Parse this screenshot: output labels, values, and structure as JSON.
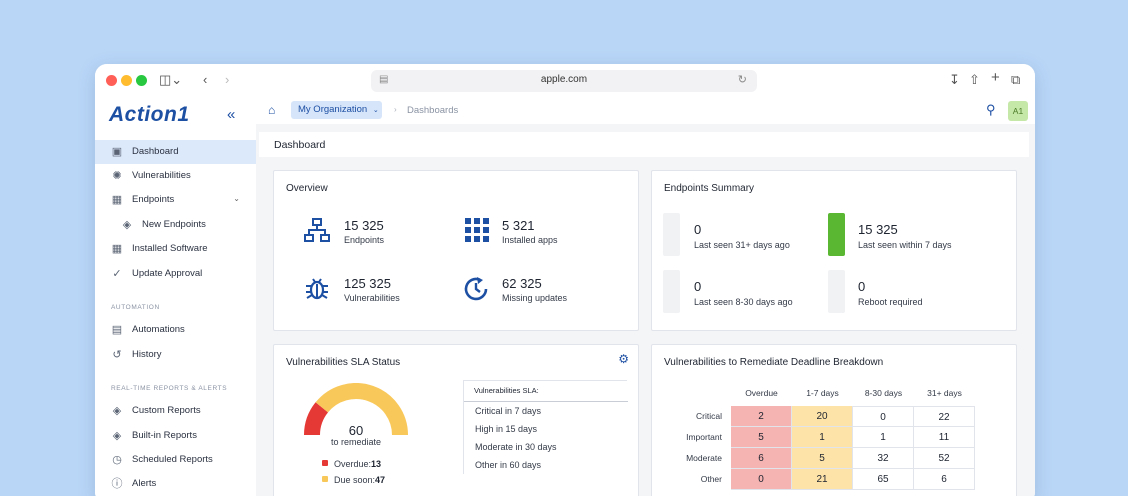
{
  "browser": {
    "url": "apple.com"
  },
  "app": {
    "logo": "Action1"
  },
  "sidebar": {
    "items": [
      {
        "label": "Dashboard",
        "icon": "monitor-icon"
      },
      {
        "label": "Vulnerabilities",
        "icon": "bug-icon"
      },
      {
        "label": "Endpoints",
        "icon": "network-icon"
      },
      {
        "label": "New Endpoints",
        "icon": "layers-icon"
      },
      {
        "label": "Installed Software",
        "icon": "grid-icon"
      },
      {
        "label": "Update Approval",
        "icon": "check-icon"
      }
    ],
    "automation_heading": "AUTOMATION",
    "automation_items": [
      {
        "label": "Automations",
        "icon": "calendar-icon"
      },
      {
        "label": "History",
        "icon": "history-icon"
      }
    ],
    "reports_heading": "REAL-TIME REPORTS & ALERTS",
    "reports_items": [
      {
        "label": "Custom Reports",
        "icon": "layers-icon"
      },
      {
        "label": "Built-in Reports",
        "icon": "layers-icon"
      },
      {
        "label": "Scheduled Reports",
        "icon": "clock-icon"
      },
      {
        "label": "Alerts",
        "icon": "info-icon"
      }
    ]
  },
  "header": {
    "org_label": "My Organization",
    "breadcrumb": "Dashboards",
    "avatar": "A1"
  },
  "page": {
    "title": "Dashboard"
  },
  "overview": {
    "title": "Overview",
    "stats": [
      {
        "value": "15 325",
        "label": "Endpoints",
        "icon": "network-icon"
      },
      {
        "value": "5 321",
        "label": "Installed apps",
        "icon": "grid-icon"
      },
      {
        "value": "125 325",
        "label": "Vulnerabilities",
        "icon": "bug-icon"
      },
      {
        "value": "62 325",
        "label": "Missing updates",
        "icon": "refresh-clock-icon"
      }
    ]
  },
  "endpoints_summary": {
    "title": "Endpoints Summary",
    "items": [
      {
        "value": "0",
        "label": "Last seen 31+ days ago",
        "color": "#f1f2f4"
      },
      {
        "value": "15 325",
        "label": "Last seen within 7 days",
        "color": "#5ab732"
      },
      {
        "value": "0",
        "label": "Last seen 8-30 days ago",
        "color": "#f1f2f4"
      },
      {
        "value": "0",
        "label": "Reboot required",
        "color": "#f1f2f4"
      }
    ]
  },
  "sla_status": {
    "title": "Vulnerabilities SLA Status",
    "gauge_value": "60",
    "gauge_label": "to remediate",
    "overdue_label": "Overdue:",
    "overdue_value": 13,
    "due_soon_label": "Due soon:",
    "due_soon_value": 47,
    "overdue_color": "#e53935",
    "due_soon_color": "#f9c85a",
    "sla_heading": "Vulnerabilities SLA:",
    "sla_items": [
      "Critical in 7 days",
      "High in 15 days",
      "Moderate in 30 days",
      "Other in 60 days"
    ]
  },
  "deadline_breakdown": {
    "title": "Vulnerabilities to Remediate Deadline Breakdown",
    "columns": [
      "Overdue",
      "1-7 days",
      "8-30 days",
      "31+ days"
    ],
    "rows": [
      {
        "label": "Critical",
        "values": [
          "2",
          "20",
          "0",
          "22"
        ]
      },
      {
        "label": "Important",
        "values": [
          "5",
          "1",
          "1",
          "11"
        ]
      },
      {
        "label": "Moderate",
        "values": [
          "6",
          "5",
          "32",
          "52"
        ]
      },
      {
        "label": "Other",
        "values": [
          "0",
          "21",
          "65",
          "6"
        ]
      }
    ]
  }
}
